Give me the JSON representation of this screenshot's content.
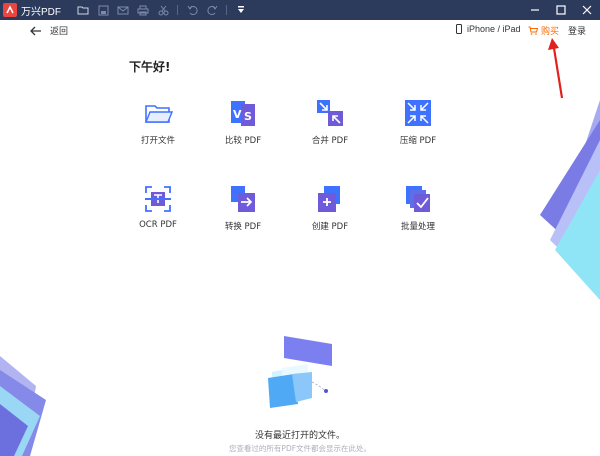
{
  "app": {
    "title": "万兴PDF"
  },
  "colors": {
    "titlebar": "#2c3a5c",
    "accent_buy": "#ff6a00",
    "tool_blue": "#3f72ff",
    "tool_purple": "#6f5bd9"
  },
  "toolbar_icons": [
    "folder-icon",
    "save-icon",
    "mail-icon",
    "print-icon",
    "scissors-icon",
    "undo-icon",
    "redo-icon",
    "dropdown-icon"
  ],
  "window_controls": [
    "minimize-icon",
    "maximize-icon",
    "close-icon"
  ],
  "topbar": {
    "back_label": "返回",
    "device_label": "iPhone / iPad",
    "buy_label": "购买",
    "login_label": "登录"
  },
  "greeting": "下午好!",
  "tools": [
    {
      "label": "打开文件",
      "icon": "open-folder-icon"
    },
    {
      "label": "比较 PDF",
      "icon": "compare-pdf-icon"
    },
    {
      "label": "合并 PDF",
      "icon": "merge-pdf-icon"
    },
    {
      "label": "压缩 PDF",
      "icon": "compress-pdf-icon"
    },
    {
      "label": "OCR PDF",
      "icon": "ocr-pdf-icon"
    },
    {
      "label": "转换 PDF",
      "icon": "convert-pdf-icon"
    },
    {
      "label": "创建 PDF",
      "icon": "create-pdf-icon"
    },
    {
      "label": "批量处理",
      "icon": "batch-process-icon"
    }
  ],
  "empty_state": {
    "message": "没有最近打开的文件。",
    "sub": "您查看过的所有PDF文件都会显示在此处。"
  }
}
